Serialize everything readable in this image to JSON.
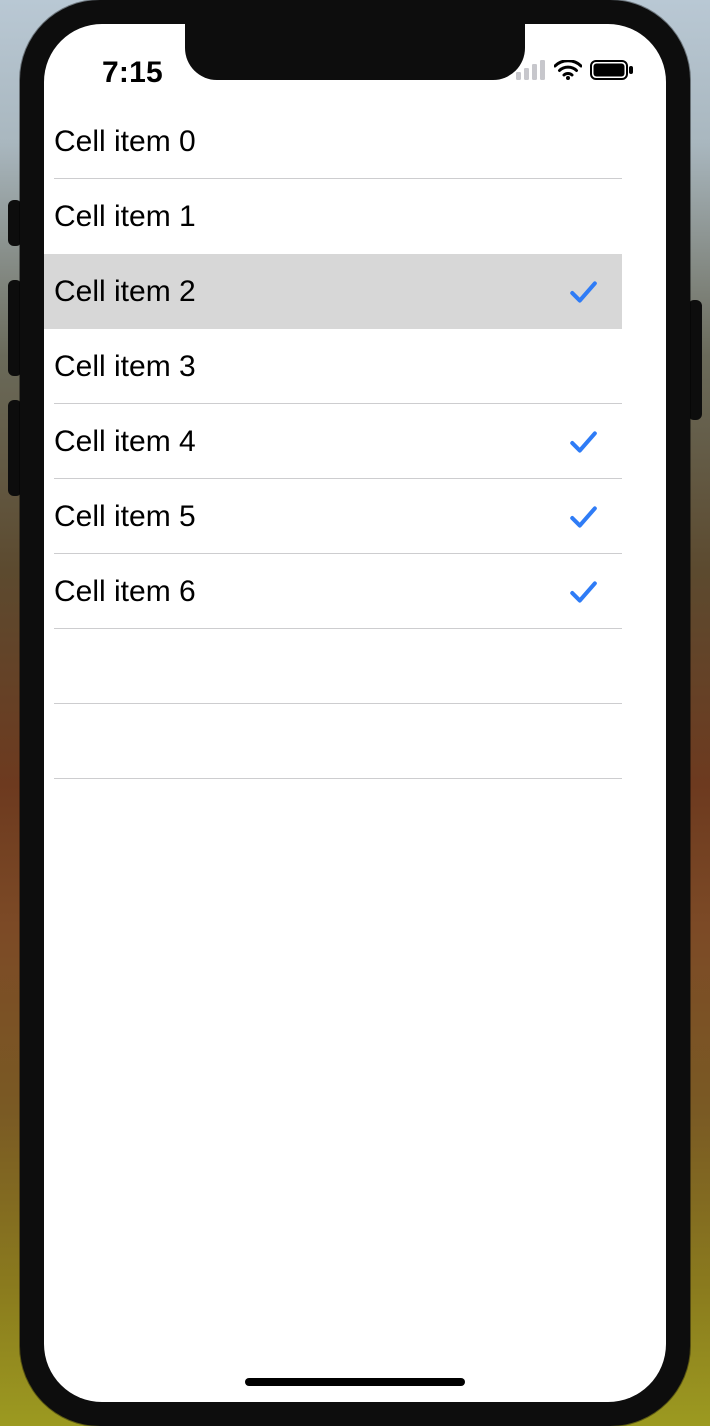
{
  "status": {
    "time": "7:15"
  },
  "table": {
    "cells": [
      {
        "label": "Cell item 0",
        "checked": false,
        "selected": false
      },
      {
        "label": "Cell item 1",
        "checked": false,
        "selected": false
      },
      {
        "label": "Cell item 2",
        "checked": true,
        "selected": true
      },
      {
        "label": "Cell item 3",
        "checked": false,
        "selected": false
      },
      {
        "label": "Cell item 4",
        "checked": true,
        "selected": false
      },
      {
        "label": "Cell item 5",
        "checked": true,
        "selected": false
      },
      {
        "label": "Cell item 6",
        "checked": true,
        "selected": false
      }
    ],
    "trailing_empty_rows": 2
  },
  "colors": {
    "accent": "#2f7cf6",
    "cell_selected_bg": "#d7d7d7",
    "separator": "#cdcdcf"
  }
}
